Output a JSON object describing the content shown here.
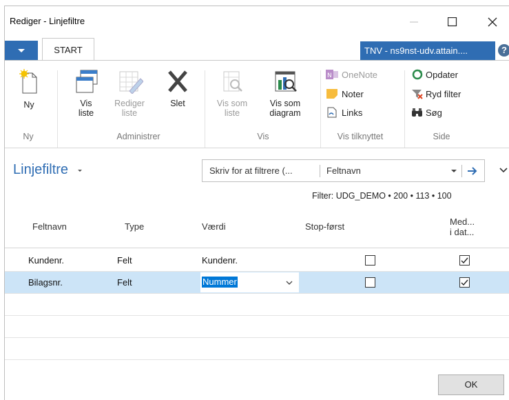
{
  "window": {
    "title": "Rediger - Linjefiltre"
  },
  "tabs": {
    "start_label": "START",
    "connection_label": "TNV - ns9nst-udv.attain...."
  },
  "ribbon": {
    "groups": {
      "ny": "Ny",
      "administrer": "Administrer",
      "vis": "Vis",
      "vis_tilknyttet": "Vis tilknyttet",
      "side": "Side"
    },
    "buttons": {
      "ny": "Ny",
      "vis_liste_1": "Vis",
      "vis_liste_2": "liste",
      "rediger_liste_1": "Rediger",
      "rediger_liste_2": "liste",
      "slet": "Slet",
      "vis_som_liste_1": "Vis som",
      "vis_som_liste_2": "liste",
      "vis_som_diagram_1": "Vis som",
      "vis_som_diagram_2": "diagram",
      "onenote": "OneNote",
      "noter": "Noter",
      "links": "Links",
      "opdater": "Opdater",
      "ryd_filter": "Ryd filter",
      "soeg": "Søg"
    }
  },
  "page": {
    "title": "Linjefiltre"
  },
  "filter": {
    "placeholder": "Skriv for at filtrere (...",
    "field": "Feltnavn",
    "summary": "Filter: UDG_DEMO • 200 • 113 • 100"
  },
  "grid": {
    "headers": {
      "feltnavn": "Feltnavn",
      "type": "Type",
      "vaerdi": "Værdi",
      "stop_foerst": "Stop-først",
      "med_1": "Med...",
      "med_2": "i dat..."
    },
    "rows": [
      {
        "feltnavn": "Kundenr.",
        "type": "Felt",
        "vaerdi": "Kundenr.",
        "stop_foerst": false,
        "med": true
      },
      {
        "feltnavn": "Bilagsnr.",
        "type": "Felt",
        "vaerdi": "Nummer",
        "stop_foerst": false,
        "med": true
      }
    ]
  },
  "footer": {
    "ok_label": "OK"
  },
  "colors": {
    "accent": "#2f6db3",
    "selected_row": "#cce4f7"
  }
}
